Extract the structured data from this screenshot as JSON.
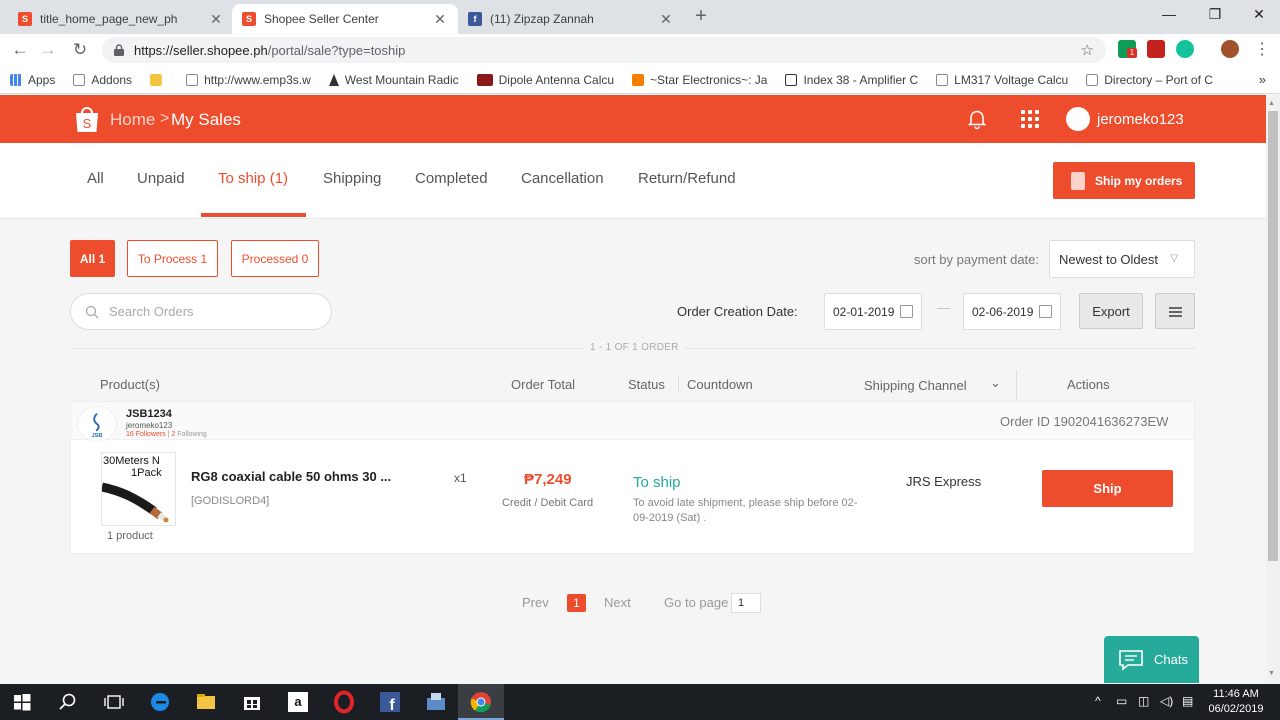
{
  "browser": {
    "tabs": [
      {
        "title": "title_home_page_new_ph",
        "icon": "shopee-favicon",
        "active": false
      },
      {
        "title": "Shopee Seller Center",
        "icon": "shopee-favicon",
        "active": true
      },
      {
        "title": "(11) Zipzap Zannah",
        "icon": "facebook-favicon",
        "active": false
      }
    ],
    "url_host": "https://seller.shopee.ph",
    "url_path": "/portal/sale?type=toship",
    "bookmarks": [
      {
        "label": "Apps",
        "icon": "apps-grid-icon"
      },
      {
        "label": "Addons",
        "icon": "page-icon"
      },
      {
        "label": "",
        "icon": "folder-icon"
      },
      {
        "label": "http://www.emp3s.w",
        "icon": "page-icon"
      },
      {
        "label": "West Mountain Radic",
        "icon": "tower-icon"
      },
      {
        "label": "Dipole Antenna Calcu",
        "icon": "rb-icon"
      },
      {
        "label": "~Star Electronics~: Ja",
        "icon": "blogger-icon"
      },
      {
        "label": "Index 38 - Amplifier C",
        "icon": "index-icon"
      },
      {
        "label": "LM317 Voltage Calcu",
        "icon": "page-icon"
      },
      {
        "label": "Directory – Port of C",
        "icon": "page-icon"
      }
    ],
    "ext_badge": "1"
  },
  "header": {
    "home": "Home",
    "separator": ">",
    "current": "My Sales",
    "username": "jeromeko123"
  },
  "status_tabs": [
    {
      "label": "All",
      "active": false
    },
    {
      "label": "Unpaid",
      "active": false
    },
    {
      "label": "To ship (1)",
      "active": true
    },
    {
      "label": "Shipping",
      "active": false
    },
    {
      "label": "Completed",
      "active": false
    },
    {
      "label": "Cancellation",
      "active": false
    },
    {
      "label": "Return/Refund",
      "active": false
    }
  ],
  "ship_my_orders": "Ship my orders",
  "filters": {
    "chips": [
      "All 1",
      "To Process 1",
      "Processed 0"
    ],
    "sort_label": "sort by payment date:",
    "sort_value": "Newest to Oldest",
    "search_placeholder": "Search Orders",
    "date_label": "Order Creation Date:",
    "date_from": "02-01-2019",
    "date_dash": "—",
    "date_to": "02-06-2019",
    "export": "Export"
  },
  "count_label": "1 - 1 OF 1 ORDER",
  "table_headers": {
    "products": "Product(s)",
    "order_total": "Order Total",
    "status": "Status",
    "countdown": "Countdown",
    "shipping_channel": "Shipping Channel",
    "actions": "Actions"
  },
  "order": {
    "shop_name": "JSB1234",
    "shop_user": "jeromeko123",
    "shop_followers": "16 Followers",
    "shop_following": "2 Following",
    "shop_logo_text": "JSB",
    "order_id": "Order ID 1902041636273EW",
    "image_text_line1": "30Meters N",
    "image_text_line2": "1Pack",
    "product_count": "1 product",
    "product_name": "RG8 coaxial cable 50 ohms 30 ...",
    "sku": "[GODISLORD4]",
    "quantity": "x1",
    "price": "₱7,249",
    "payment": "Credit / Debit Card",
    "status": "To ship",
    "status_note": "To avoid late shipment, please ship before 02-09-2019 (Sat) .",
    "channel": "JRS Express",
    "ship_button": "Ship"
  },
  "pagination": {
    "prev": "Prev",
    "current": "1",
    "next": "Next",
    "goto_label": "Go to page",
    "goto_value": "1"
  },
  "chats": "Chats",
  "taskbar": {
    "time": "11:46 AM",
    "date": "06/02/2019"
  },
  "colors": {
    "brand": "#ee4d2d",
    "status_teal": "#26aa99"
  }
}
